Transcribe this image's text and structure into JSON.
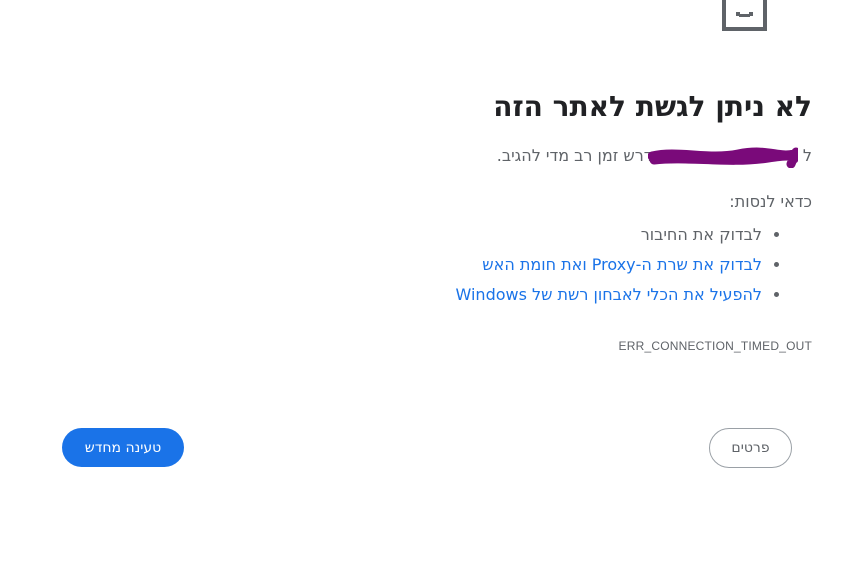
{
  "error_page": {
    "title": "לא ניתן לגשת לאתר הזה",
    "subtitle_prefix": "ל",
    "subtitle_suffix": "נדרש זמן רב מדי להגיב.",
    "try_heading": "כדאי לנסות:",
    "suggestions": [
      {
        "label": "לבדוק את החיבור",
        "is_link": false
      },
      {
        "label": "לבדוק את שרת ה-Proxy ואת חומת האש",
        "is_link": true
      },
      {
        "label": "להפעיל את הכלי לאבחון רשת של Windows",
        "is_link": true
      }
    ],
    "error_code": "ERR_CONNECTION_TIMED_OUT"
  },
  "buttons": {
    "reload_label": "טעינה מחדש",
    "details_label": "פרטים"
  },
  "icons": {
    "top_icon": "sad-page-icon"
  },
  "colors": {
    "accent": "#1a73e8",
    "text_primary": "#202124",
    "text_secondary": "#5f6368",
    "redaction": "#7a0a7a"
  }
}
